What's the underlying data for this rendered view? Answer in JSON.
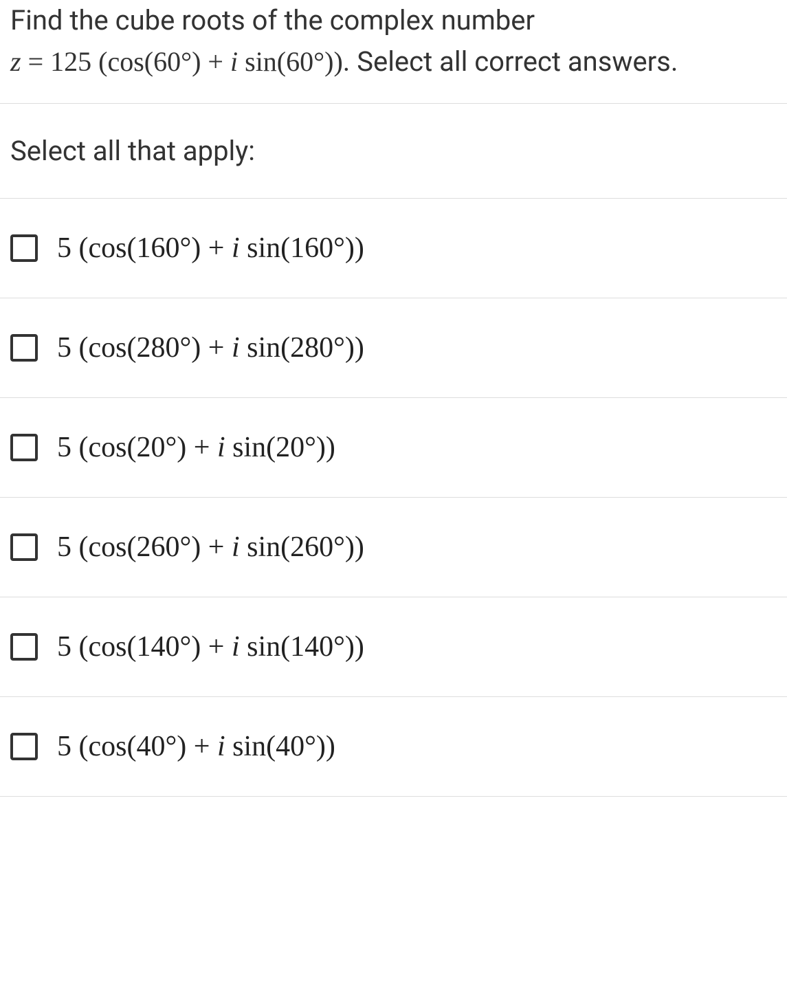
{
  "question": {
    "line1": "Find the cube roots of the complex number",
    "z_label": "z",
    "eq": " = ",
    "modulus": "125",
    "open": " (cos(",
    "angle": "60°",
    "mid": ") + ",
    "i": "i",
    "sin_open": " sin(",
    "close": "))",
    "tail": ". Select all correct answers."
  },
  "instruction": "Select all that apply:",
  "options": [
    {
      "r": "5",
      "angle": "160°"
    },
    {
      "r": "5",
      "angle": "280°"
    },
    {
      "r": "5",
      "angle": "20°"
    },
    {
      "r": "5",
      "angle": "260°"
    },
    {
      "r": "5",
      "angle": "140°"
    },
    {
      "r": "5",
      "angle": "40°"
    }
  ]
}
